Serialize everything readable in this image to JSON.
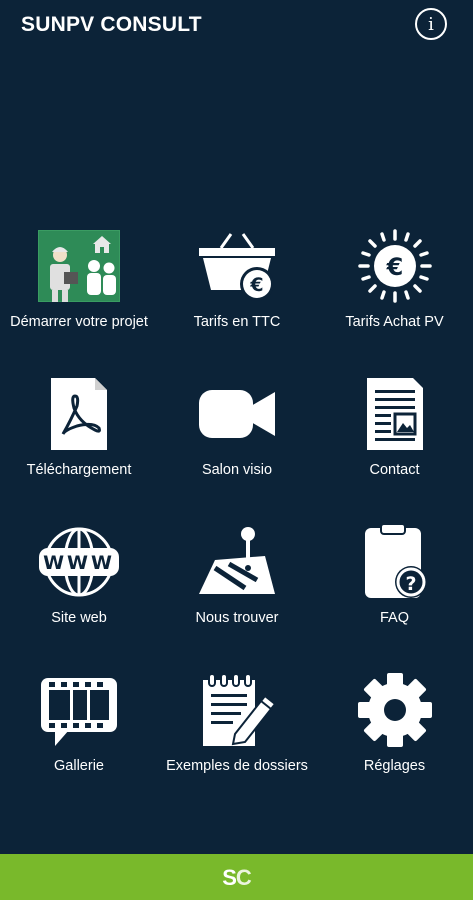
{
  "app": {
    "title": "SUNPV CONSULT",
    "info_label": "i"
  },
  "colors": {
    "background": "#0c2338",
    "footer": "#79b92b",
    "accent": "#ffffff"
  },
  "menu": [
    {
      "label": "Démarrer votre projet",
      "icon": "project-illustration-icon"
    },
    {
      "label": "Tarifs en TTC",
      "icon": "basket-euro-icon"
    },
    {
      "label": "Tarifs Achat PV",
      "icon": "sun-euro-icon"
    },
    {
      "label": "Téléchargement",
      "icon": "pdf-document-icon"
    },
    {
      "label": "Salon visio",
      "icon": "video-camera-icon"
    },
    {
      "label": "Contact",
      "icon": "newspaper-icon"
    },
    {
      "label": "Site web",
      "icon": "www-globe-icon"
    },
    {
      "label": "Nous trouver",
      "icon": "map-pin-icon"
    },
    {
      "label": "FAQ",
      "icon": "clipboard-question-icon"
    },
    {
      "label": "Gallerie",
      "icon": "film-strip-icon"
    },
    {
      "label": "Exemples de dossiers",
      "icon": "notepad-pencil-icon"
    },
    {
      "label": "Réglages",
      "icon": "gear-icon"
    }
  ],
  "footer": {
    "logo_s": "S",
    "logo_c": "C"
  }
}
